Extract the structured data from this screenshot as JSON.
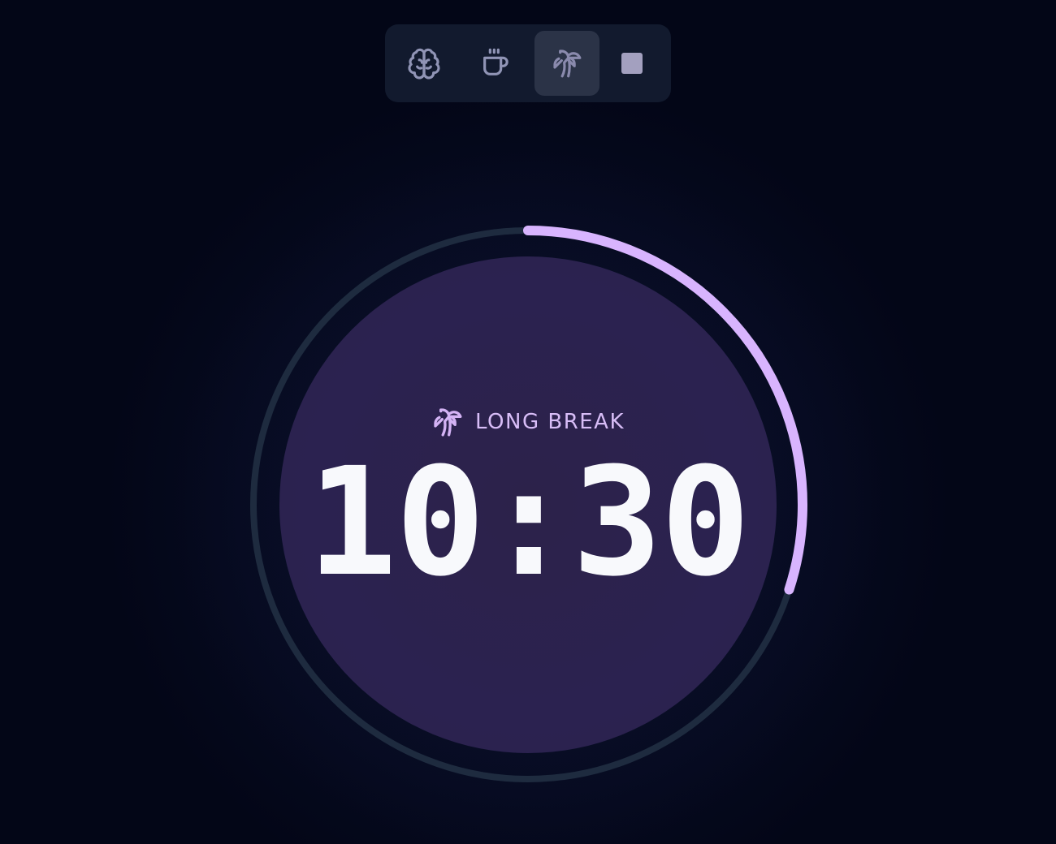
{
  "toolbar": {
    "buttons": [
      {
        "icon": "brain-icon",
        "label": "Focus"
      },
      {
        "icon": "coffee-cup-icon",
        "label": "Short break"
      },
      {
        "icon": "palm-tree-icon",
        "label": "Long break",
        "active": true
      },
      {
        "icon": "stop-icon",
        "label": "Stop"
      }
    ]
  },
  "timer": {
    "mode_label": "LONG BREAK",
    "mode_icon": "palm-tree-icon",
    "time": "10:30",
    "progress_fraction": 0.3
  },
  "colors": {
    "background": "#030617",
    "face": "#2b2250",
    "accent": "#d8b4fe",
    "track": "#1e2b3f",
    "time_text": "#f8f9fc"
  }
}
